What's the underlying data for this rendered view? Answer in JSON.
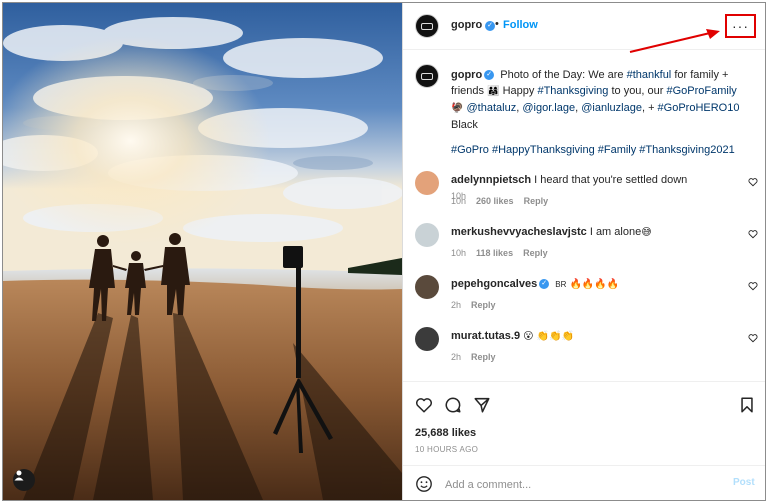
{
  "post": {
    "username": "gopro",
    "follow_label": "Follow",
    "separator": "•",
    "more_label": "···"
  },
  "caption": {
    "username": "gopro",
    "line1_text": "Photo of the Day: We are ",
    "line1_tag": "#thankful",
    "line1_rest": " for family + friends",
    "line2_emoji": "👨‍👩‍👧",
    "line2_text": " Happy ",
    "line2_tag": "#Thanksgiving",
    "line2_rest": " to you, our ",
    "line2_tag2": "#GoProFamily",
    "line2_emoji2": "🦃",
    "line2_mention": "@thataluz",
    "line3_mention1": "@igor.lage",
    "line3_mention2": "@ianluzlage",
    "line3_plus": ", + ",
    "line3_tag": "#GoProHERO10",
    "line3_rest": " Black",
    "hashtags": "#GoPro #HappyThanksgiving #Family #Thanksgiving2021",
    "time": "10h"
  },
  "comments": [
    {
      "username": "adelynnpietsch",
      "text": "I heard that you're settled down",
      "time": "10h",
      "likes": "260 likes",
      "reply": "Reply"
    },
    {
      "username": "merkushevvyacheslavjstc",
      "text": "I am alone",
      "emoji": "😅",
      "time": "10h",
      "likes": "118 likes",
      "reply": "Reply"
    },
    {
      "username": "pepehgoncalves",
      "text": "BR",
      "emoji": "🔥🔥🔥🔥",
      "time": "2h",
      "reply": "Reply"
    },
    {
      "username": "murat.tutas.9",
      "emoji": "😮 👏👏👏",
      "time": "2h",
      "reply": "Reply"
    }
  ],
  "stats": {
    "likes": "25,688 likes",
    "time_ago": "10 HOURS AGO"
  },
  "composer": {
    "placeholder": "Add a comment...",
    "post_label": "Post"
  },
  "colors": {
    "accent": "#0095f6",
    "annotation": "#e00000"
  }
}
